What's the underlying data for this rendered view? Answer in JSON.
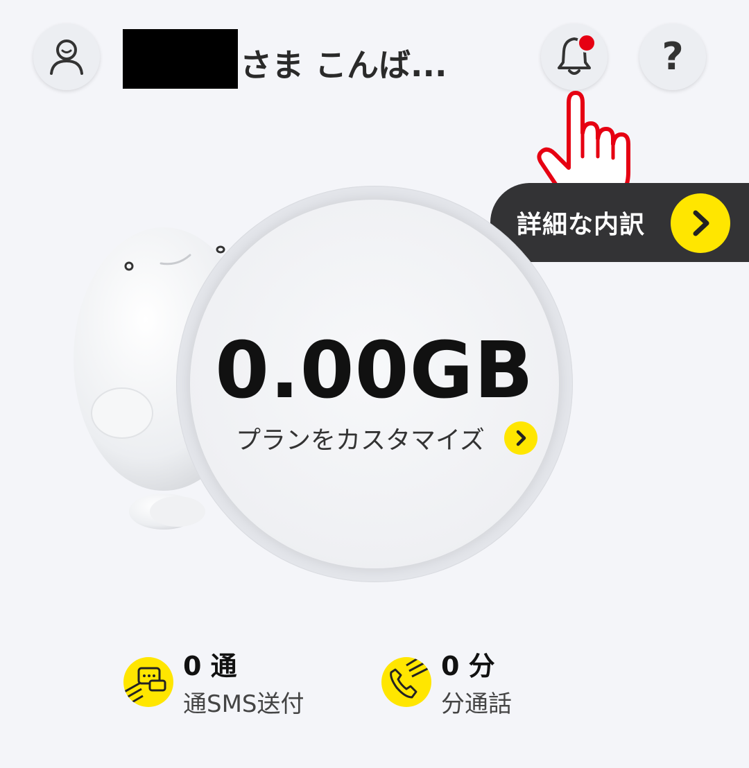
{
  "header": {
    "greeting": "さま こんば...",
    "account_icon": "person-icon",
    "bell_icon": "bell-icon",
    "help_label": "?",
    "notification_color": "#e60012"
  },
  "details_pill": {
    "label": "詳細な内訳",
    "arrow_icon": "chevron-right-icon"
  },
  "usage": {
    "data_amount": "0.00GB",
    "customize_label": "プランをカスタマイズ"
  },
  "stats": {
    "sms": {
      "value": "0 通",
      "label": "通SMS送付",
      "icon": "sms-icon"
    },
    "call": {
      "value": "0 分",
      "label": "分通話",
      "icon": "phone-icon"
    }
  },
  "colors": {
    "accent": "#ffe600",
    "dark_pill": "#333335",
    "background": "#f4f5f9",
    "hand_red": "#e60012"
  }
}
